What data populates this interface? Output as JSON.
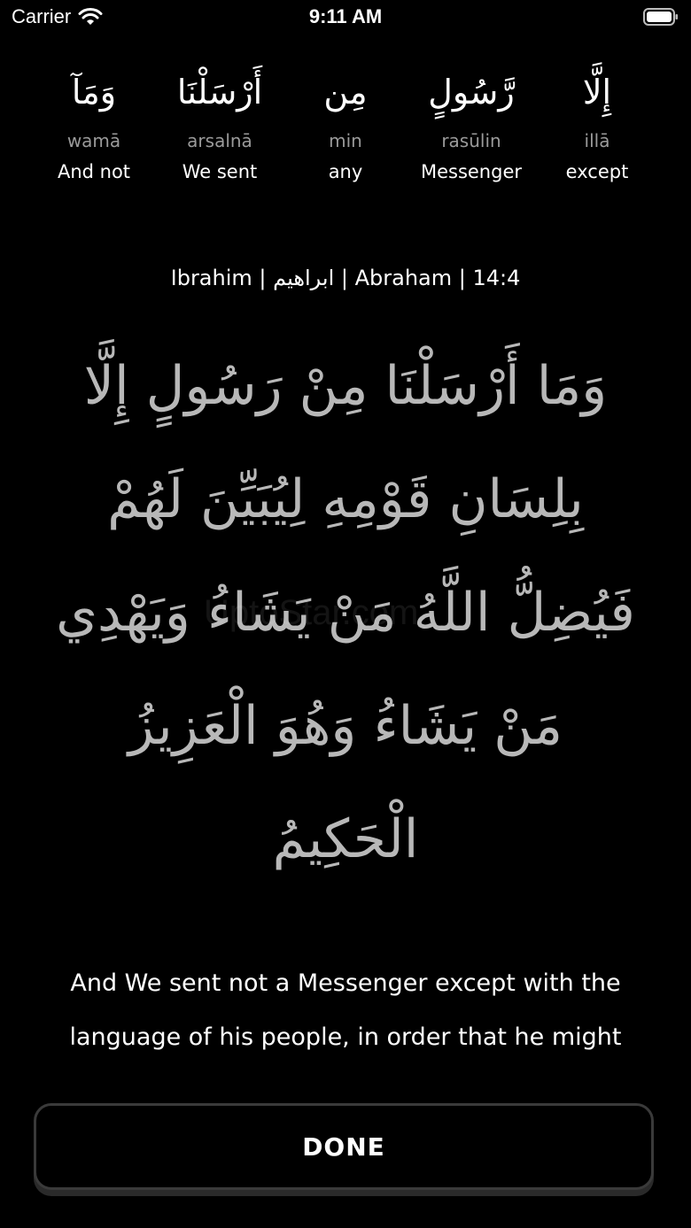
{
  "status_bar": {
    "carrier": "Carrier",
    "time": "9:11 AM"
  },
  "words": [
    {
      "arabic": "وَمَآ",
      "transliteration": "wamā",
      "english": "And not"
    },
    {
      "arabic": "أَرْسَلْنَا",
      "transliteration": "arsalnā",
      "english": "We sent"
    },
    {
      "arabic": "مِن",
      "transliteration": "min",
      "english": "any"
    },
    {
      "arabic": "رَّسُولٍ",
      "transliteration": "rasūlin",
      "english": "Messenger"
    },
    {
      "arabic": "إِلَّا",
      "transliteration": "illā",
      "english": "except"
    }
  ],
  "reference": "Ibrahim | ابراهيم | Abraham | 14:4",
  "verse_lines": [
    "وَمَا أَرْسَلْنَا مِنْ رَسُولٍ إِلَّا",
    "بِلِسَانِ قَوْمِهِ لِيُبَيِّنَ لَهُمْ",
    "فَيُضِلُّ اللَّهُ مَنْ يَشَاءُ وَيَهْدِي",
    "مَنْ يَشَاءُ وَهُوَ الْعَزِيزُ",
    "الْحَكِيمُ"
  ],
  "watermark": "UptoStar.com",
  "translation_lines": [
    "And We sent not a Messenger except with the",
    "language of his people, in order that he might"
  ],
  "done_label": "DONE"
}
